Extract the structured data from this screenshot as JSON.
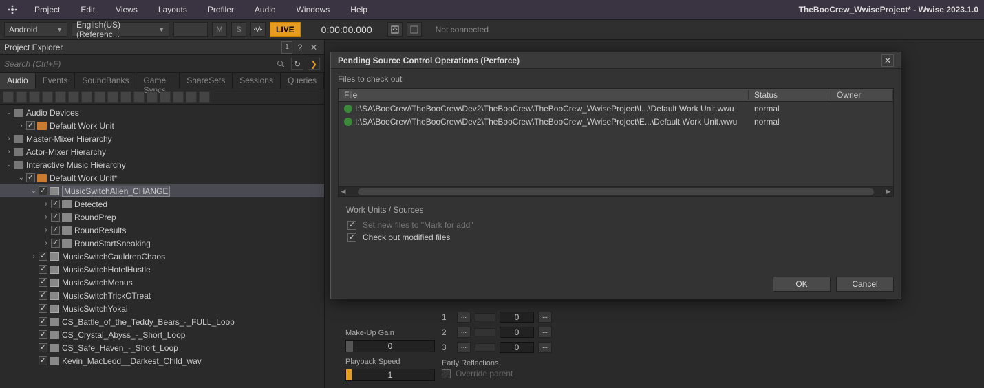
{
  "app": {
    "title": "TheBooCrew_WwiseProject* - Wwise 2023.1.0"
  },
  "menu": [
    "Project",
    "Edit",
    "Views",
    "Layouts",
    "Profiler",
    "Audio",
    "Windows",
    "Help"
  ],
  "toolbar": {
    "platform": "Android",
    "language": "English(US) (Referenc...",
    "m": "M",
    "s": "S",
    "live": "LIVE",
    "time": "0:00:00.000",
    "status": "Not connected"
  },
  "explorer": {
    "title": "Project Explorer",
    "recycle_badge": "1",
    "search_placeholder": "Search (Ctrl+F)",
    "tabs": [
      "Audio",
      "Events",
      "SoundBanks",
      "Game Syncs",
      "ShareSets",
      "Sessions",
      "Queries"
    ],
    "tree": [
      {
        "d": 0,
        "exp": "open",
        "chk": false,
        "ico": "folder",
        "label": "Audio Devices"
      },
      {
        "d": 1,
        "exp": "closed",
        "chk": true,
        "ico": "wu",
        "label": "Default Work Unit"
      },
      {
        "d": 0,
        "exp": "closed",
        "chk": false,
        "ico": "folder",
        "label": "Master-Mixer Hierarchy"
      },
      {
        "d": 0,
        "exp": "closed",
        "chk": false,
        "ico": "folder",
        "label": "Actor-Mixer Hierarchy"
      },
      {
        "d": 0,
        "exp": "open",
        "chk": false,
        "ico": "folder",
        "label": "Interactive Music Hierarchy"
      },
      {
        "d": 1,
        "exp": "open",
        "chk": true,
        "ico": "wu",
        "label": "Default Work Unit*"
      },
      {
        "d": 2,
        "exp": "open",
        "chk": true,
        "ico": "switch",
        "label": "MusicSwitchAlien_CHANGE",
        "sel": true
      },
      {
        "d": 3,
        "exp": "closed",
        "chk": true,
        "ico": "seg",
        "label": "Detected"
      },
      {
        "d": 3,
        "exp": "closed",
        "chk": true,
        "ico": "seg",
        "label": "RoundPrep"
      },
      {
        "d": 3,
        "exp": "closed",
        "chk": true,
        "ico": "seg",
        "label": "RoundResults"
      },
      {
        "d": 3,
        "exp": "closed",
        "chk": true,
        "ico": "seg",
        "label": "RoundStartSneaking"
      },
      {
        "d": 2,
        "exp": "closed",
        "chk": true,
        "ico": "switch",
        "label": "MusicSwitchCauldrenChaos"
      },
      {
        "d": 2,
        "exp": "none",
        "chk": true,
        "ico": "switch",
        "label": "MusicSwitchHotelHustle"
      },
      {
        "d": 2,
        "exp": "none",
        "chk": true,
        "ico": "switch",
        "label": "MusicSwitchMenus"
      },
      {
        "d": 2,
        "exp": "none",
        "chk": true,
        "ico": "switch",
        "label": "MusicSwitchTrickOTreat"
      },
      {
        "d": 2,
        "exp": "none",
        "chk": true,
        "ico": "switch",
        "label": "MusicSwitchYokai"
      },
      {
        "d": 2,
        "exp": "none",
        "chk": true,
        "ico": "seg",
        "label": "CS_Battle_of_the_Teddy_Bears_-_FULL_Loop"
      },
      {
        "d": 2,
        "exp": "none",
        "chk": true,
        "ico": "seg",
        "label": "CS_Crystal_Abyss_-_Short_Loop"
      },
      {
        "d": 2,
        "exp": "none",
        "chk": true,
        "ico": "seg",
        "label": "CS_Safe_Haven_-_Short_Loop"
      },
      {
        "d": 2,
        "exp": "none",
        "chk": true,
        "ico": "seg",
        "label": "Kevin_MacLeod__Darkest_Child_wav"
      }
    ]
  },
  "props": {
    "makeup_gain_label": "Make-Up Gain",
    "makeup_gain_value": "0",
    "playback_speed_label": "Playback Speed",
    "playback_speed_value": "1",
    "rows": [
      {
        "num": "1",
        "val": "0"
      },
      {
        "num": "2",
        "val": "0"
      },
      {
        "num": "3",
        "val": "0"
      }
    ],
    "early_reflections": "Early Reflections",
    "override_parent": "Override parent"
  },
  "dialog": {
    "title": "Pending Source Control Operations (Perforce)",
    "subtitle": "Files to check out",
    "columns": {
      "file": "File",
      "status": "Status",
      "owner": "Owner"
    },
    "rows": [
      {
        "file": "I:\\SA\\BooCrew\\TheBooCrew\\Dev2\\TheBooCrew\\TheBooCrew_WwiseProject\\I...\\Default Work Unit.wwu",
        "status": "normal",
        "owner": ""
      },
      {
        "file": "I:\\SA\\BooCrew\\TheBooCrew\\Dev2\\TheBooCrew\\TheBooCrew_WwiseProject\\E...\\Default Work Unit.wwu",
        "status": "normal",
        "owner": ""
      }
    ],
    "section": "Work Units / Sources",
    "opt_mark_add": "Set new files to \"Mark for add\"",
    "opt_checkout": "Check out modified files",
    "ok": "OK",
    "cancel": "Cancel"
  }
}
